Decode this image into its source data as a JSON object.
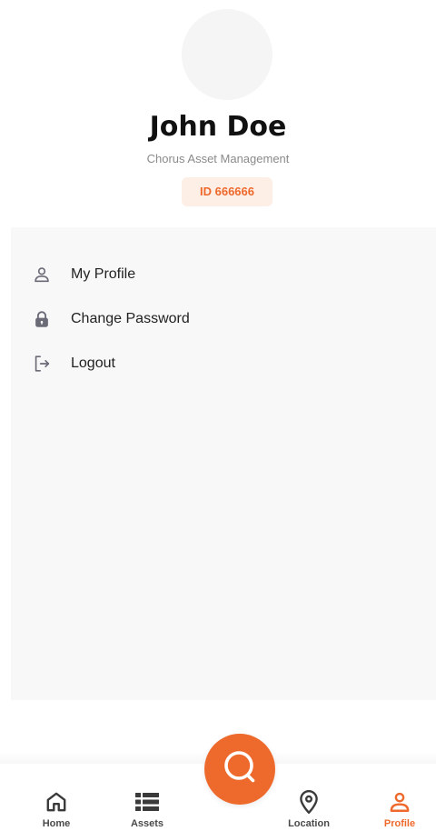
{
  "profile": {
    "name": "John Doe",
    "company": "Chorus Asset Management",
    "id_label": "ID 666666"
  },
  "menu": [
    {
      "label": "My Profile",
      "icon": "person-icon"
    },
    {
      "label": "Change Password",
      "icon": "lock-icon"
    },
    {
      "label": "Logout",
      "icon": "logout-icon"
    }
  ],
  "nav": {
    "items": [
      {
        "label": "Home",
        "icon": "home-icon"
      },
      {
        "label": "Assets",
        "icon": "list-icon"
      },
      {
        "label": "Location",
        "icon": "location-pin-icon"
      },
      {
        "label": "Profile",
        "icon": "person-icon"
      }
    ],
    "active": "Profile",
    "fab_icon": "search-icon"
  },
  "colors": {
    "accent": "#ee6a2c",
    "badge_bg": "#fdeee6",
    "panel_bg": "#f8f8f8",
    "icon_gray": "#6b6b78"
  }
}
